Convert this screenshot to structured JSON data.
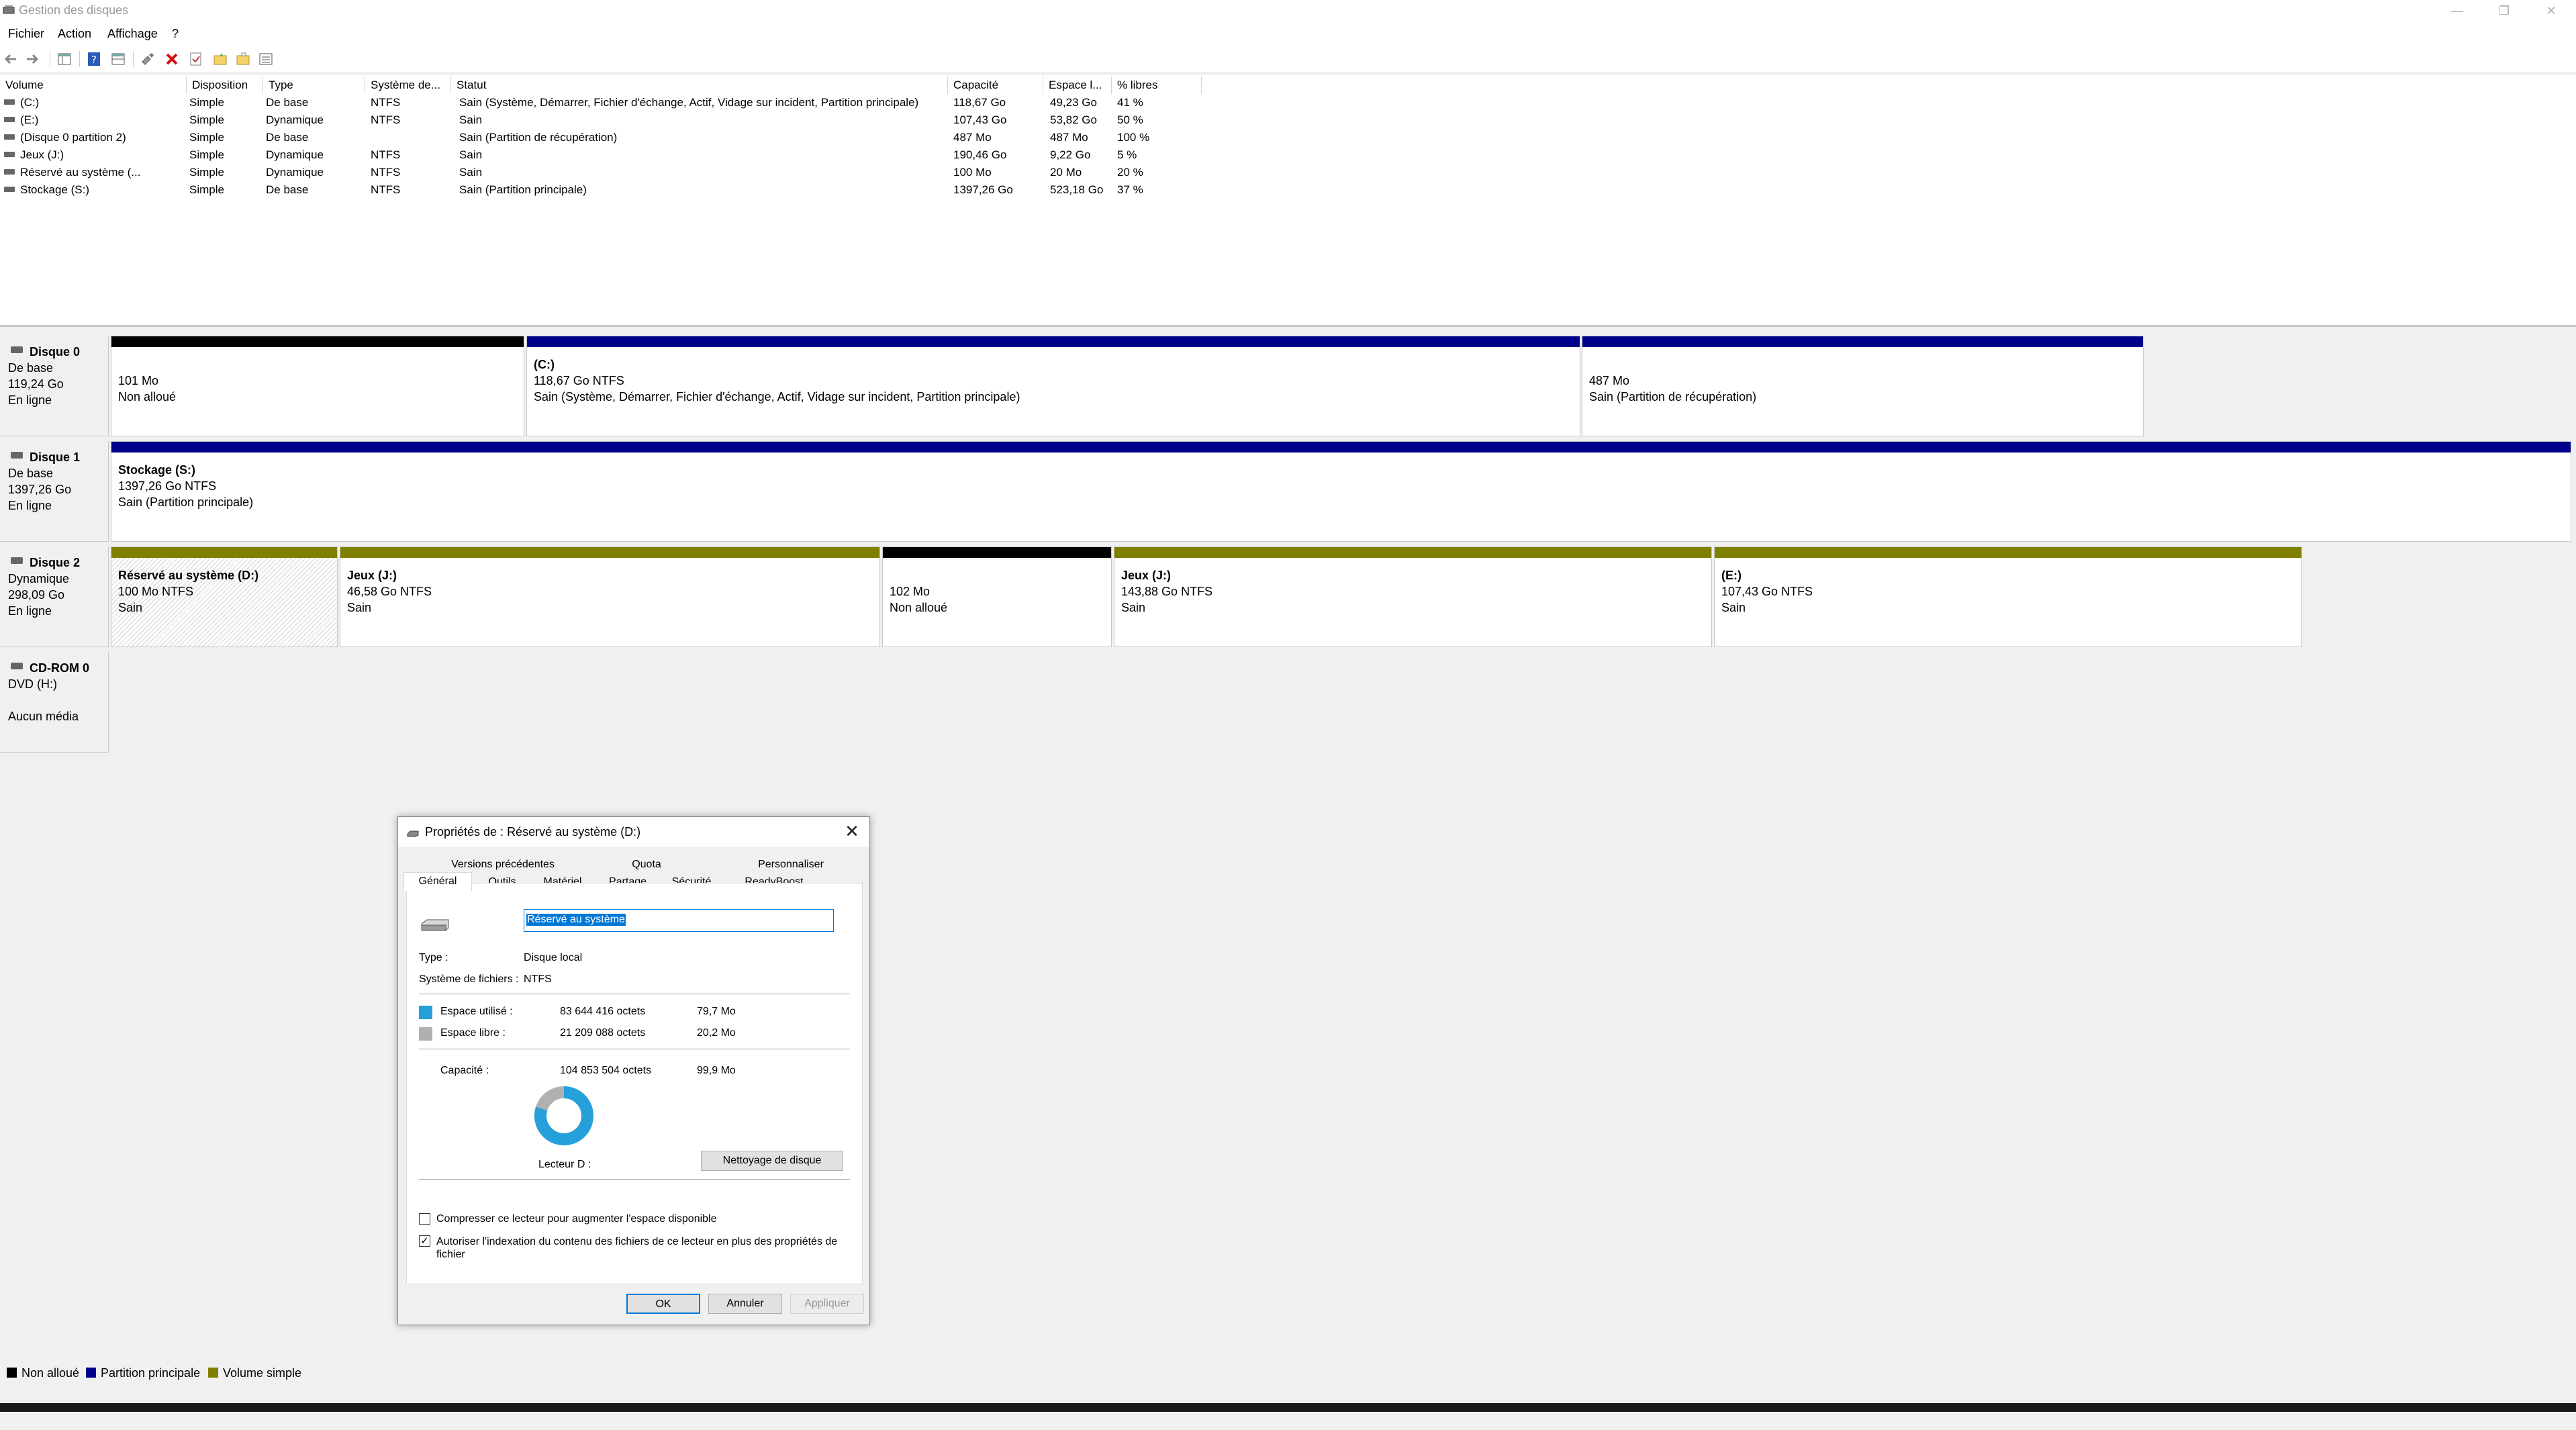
{
  "window": {
    "title": "Gestion des disques",
    "controls": [
      "—",
      "❐",
      "✕"
    ]
  },
  "menu": [
    "Fichier",
    "Action",
    "Affichage",
    "?"
  ],
  "volume_table": {
    "headers": [
      "Volume",
      "Disposition",
      "Type",
      "Système de...",
      "Statut",
      "Capacité",
      "Espace l...",
      "% libres"
    ],
    "rows": [
      [
        "(C:)",
        "Simple",
        "De base",
        "NTFS",
        "Sain (Système, Démarrer, Fichier d'échange, Actif, Vidage sur incident, Partition principale)",
        "118,67 Go",
        "49,23 Go",
        "41 %"
      ],
      [
        "(E:)",
        "Simple",
        "Dynamique",
        "NTFS",
        "Sain",
        "107,43 Go",
        "53,82 Go",
        "50 %"
      ],
      [
        "(Disque 0 partition 2)",
        "Simple",
        "De base",
        "",
        "Sain (Partition de récupération)",
        "487 Mo",
        "487 Mo",
        "100 %"
      ],
      [
        "Jeux (J:)",
        "Simple",
        "Dynamique",
        "NTFS",
        "Sain",
        "190,46 Go",
        "9,22 Go",
        "5 %"
      ],
      [
        "Réservé au système (...",
        "Simple",
        "Dynamique",
        "NTFS",
        "Sain",
        "100 Mo",
        "20 Mo",
        "20 %"
      ],
      [
        "Stockage (S:)",
        "Simple",
        "De base",
        "NTFS",
        "Sain (Partition principale)",
        "1397,26 Go",
        "523,18 Go",
        "37 %"
      ]
    ]
  },
  "disks": [
    {
      "name": "Disque 0",
      "type": "De base",
      "size": "119,24 Go",
      "status": "En ligne",
      "parts": [
        {
          "title": "",
          "l1": "101 Mo",
          "l2": "Non alloué",
          "color": "#000000"
        },
        {
          "title": "(C:)",
          "l1": "118,67 Go NTFS",
          "l2": "Sain (Système, Démarrer, Fichier d'échange, Actif, Vidage sur incident, Partition principale)",
          "color": "#00008b"
        },
        {
          "title": "",
          "l1": "487 Mo",
          "l2": "Sain (Partition de récupération)",
          "color": "#00008b"
        }
      ]
    },
    {
      "name": "Disque 1",
      "type": "De base",
      "size": "1397,26 Go",
      "status": "En ligne",
      "parts": [
        {
          "title": "Stockage  (S:)",
          "l1": "1397,26 Go NTFS",
          "l2": "Sain (Partition principale)",
          "color": "#00008b"
        }
      ]
    },
    {
      "name": "Disque 2",
      "type": "Dynamique",
      "size": "298,09 Go",
      "status": "En ligne",
      "parts": [
        {
          "title": "Réservé au système  (D:)",
          "l1": "100 Mo NTFS",
          "l2": "Sain",
          "color": "#808000"
        },
        {
          "title": "Jeux  (J:)",
          "l1": "46,58 Go NTFS",
          "l2": "Sain",
          "color": "#808000"
        },
        {
          "title": "",
          "l1": "102 Mo",
          "l2": "Non alloué",
          "color": "#000000"
        },
        {
          "title": "Jeux  (J:)",
          "l1": "143,88 Go NTFS",
          "l2": "Sain",
          "color": "#808000"
        },
        {
          "title": "(E:)",
          "l1": "107,43 Go NTFS",
          "l2": "Sain",
          "color": "#808000"
        }
      ]
    },
    {
      "name": "CD-ROM 0",
      "type": "DVD (H:)",
      "size": "",
      "status": "Aucun média",
      "parts": []
    }
  ],
  "legend": [
    {
      "label": "Non alloué",
      "color": "#000000"
    },
    {
      "label": "Partition principale",
      "color": "#00008b"
    },
    {
      "label": "Volume simple",
      "color": "#808000"
    }
  ],
  "dialog": {
    "title": "Propriétés de : Réservé au système (D:)",
    "tabs_row1": [
      "Versions précédentes",
      "Quota",
      "Personnaliser"
    ],
    "tabs_row2": [
      "Général",
      "Outils",
      "Matériel",
      "Partage",
      "Sécurité",
      "ReadyBoost"
    ],
    "name_value": "Réservé au système",
    "type_label": "Type :",
    "type_value": "Disque local",
    "fs_label": "Système de fichiers :",
    "fs_value": "NTFS",
    "used_label": "Espace utilisé :",
    "used_bytes": "83 644 416 octets",
    "used_h": "79,7 Mo",
    "free_label": "Espace libre :",
    "free_bytes": "21 209 088 octets",
    "free_h": "20,2 Mo",
    "cap_label": "Capacité :",
    "cap_bytes": "104 853 504 octets",
    "cap_h": "99,9 Mo",
    "used_fraction": 0.798,
    "used_color": "#26a0da",
    "free_color": "#b0b0b0",
    "drive_label": "Lecteur D :",
    "cleanup_button": "Nettoyage de disque",
    "compress_label": "Compresser ce lecteur pour augmenter l'espace disponible",
    "compress_checked": false,
    "index_label": "Autoriser l'indexation du contenu des fichiers de ce lecteur en plus des propriétés de fichier",
    "index_checked": true,
    "ok": "OK",
    "cancel": "Annuler",
    "apply": "Appliquer"
  }
}
